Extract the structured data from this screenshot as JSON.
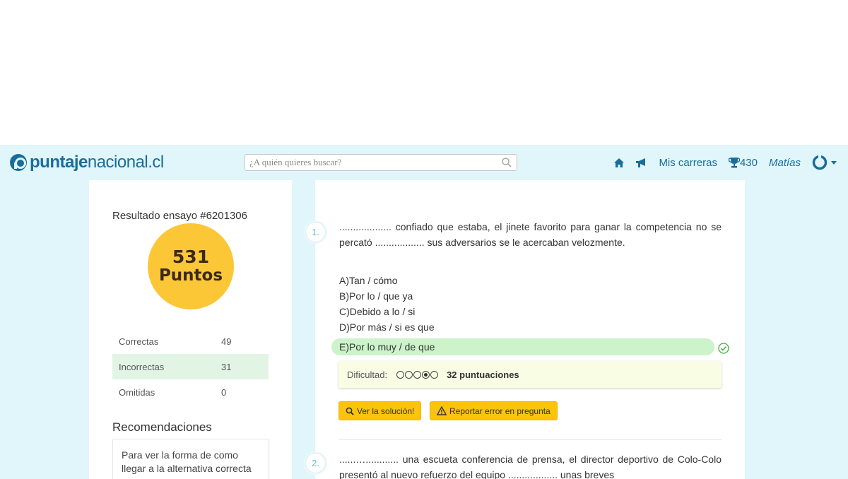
{
  "navbar": {
    "logo_bold": "puntaje",
    "logo_rest": "nacional.cl",
    "search_placeholder": "¿A quién quieres buscar?",
    "mis_carreras": "Mis carreras",
    "trophy_points": "430",
    "user_name": "Matías"
  },
  "sidebar": {
    "result_title": "Resultado ensayo #6201306",
    "score_number": "531",
    "score_label": "Puntos",
    "stats": [
      {
        "label": "Correctas",
        "value": "49"
      },
      {
        "label": "Incorrectas",
        "value": "31"
      },
      {
        "label": "Omitidas",
        "value": "0"
      }
    ],
    "recommendations_title": "Recomendaciones",
    "recommendations_text": "Para ver la forma de como llegar a la alternativa correcta"
  },
  "questions": [
    {
      "number": "1.",
      "text": "................... confiado que estaba, el jinete favorito para ganar la competencia no se percató .................. sus adversarios se le acercaban velozmente.",
      "options": [
        "A)Tan / cómo",
        "B)Por lo / que ya",
        "C)Debido a lo / si",
        "D)Por más / si es que"
      ],
      "correct_option": "E)Por lo muy / de que",
      "difficulty_label": "Dificultad:",
      "difficulty_level": 4,
      "difficulty_max": 5,
      "ratings": "32 puntuaciones",
      "btn_solution": "Ver la solución!",
      "btn_report": "Reportar error en pregunta"
    },
    {
      "number": "2.",
      "text": "......…............ una escueta conferencia de prensa, el director deportivo de Colo-Colo presentó al nuevo refuerzo del equipo .................. unas breves"
    }
  ],
  "colors": {
    "brand": "#1a6d9a",
    "nav_bg": "#e0f6fb",
    "score_circle": "#fcc737",
    "correct_bg": "#ccf3c9",
    "button": "#fcc30d"
  }
}
